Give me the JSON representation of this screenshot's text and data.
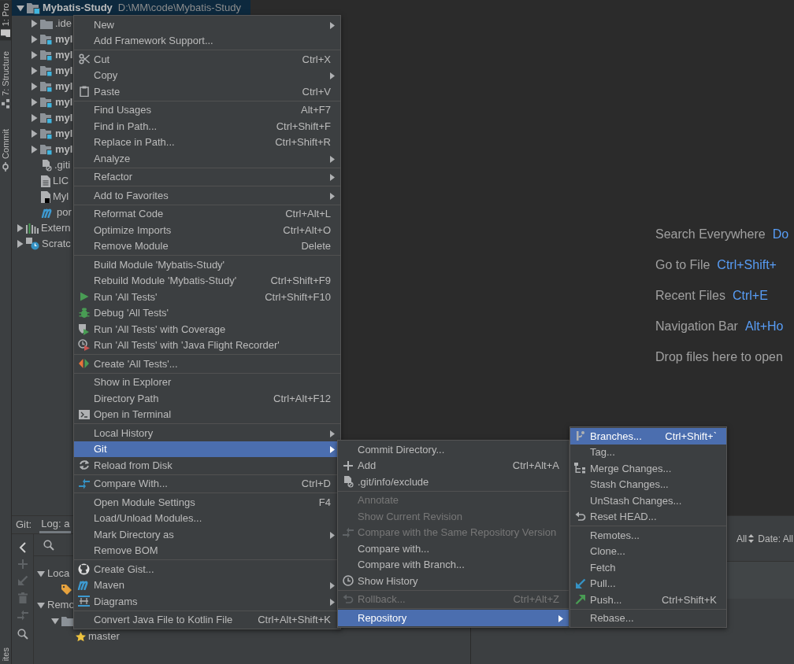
{
  "tool_strip": {
    "tabs": [
      {
        "label": "1: Pro",
        "selected": true
      },
      {
        "label": "7: Structure",
        "selected": false
      },
      {
        "label": "Commit",
        "selected": false
      }
    ],
    "bottom_tab": {
      "label": "ites"
    }
  },
  "project_tree": [
    {
      "label": "Mybatis-Study",
      "path": "D:\\MM\\code\\Mybatis-Study",
      "kind": "project",
      "expanded": true,
      "selected": true,
      "children": [
        {
          "label": ".ide",
          "kind": "folder",
          "expanded": false,
          "selected": false
        },
        {
          "label": "myl",
          "kind": "module",
          "expanded": false,
          "selected": false
        },
        {
          "label": "myl",
          "kind": "module",
          "expanded": false,
          "selected": false
        },
        {
          "label": "myl",
          "kind": "module",
          "expanded": false,
          "selected": false
        },
        {
          "label": "myl",
          "kind": "module",
          "expanded": false,
          "selected": false
        },
        {
          "label": "myl",
          "kind": "module",
          "expanded": false,
          "selected": false
        },
        {
          "label": "myl",
          "kind": "module",
          "expanded": false,
          "selected": false
        },
        {
          "label": "myl",
          "kind": "module",
          "expanded": false,
          "selected": false
        },
        {
          "label": "myl",
          "kind": "module",
          "expanded": false,
          "selected": false
        },
        {
          "label": ".giti",
          "kind": "ignored",
          "selected": false
        },
        {
          "label": "LIC",
          "kind": "text",
          "selected": false
        },
        {
          "label": "Myl",
          "kind": "markdown",
          "selected": false
        },
        {
          "label": "por",
          "kind": "maven",
          "selected": false
        }
      ]
    },
    {
      "label": "Extern",
      "kind": "library",
      "expanded": false,
      "selected": false
    },
    {
      "label": "Scratc",
      "kind": "scratch",
      "expanded": false,
      "selected": false
    }
  ],
  "editor_hints": [
    {
      "label": "Search Everywhere",
      "shortcut": "Do"
    },
    {
      "label": "Go to File",
      "shortcut": "Ctrl+Shift+"
    },
    {
      "label": "Recent Files",
      "shortcut": "Ctrl+E"
    },
    {
      "label": "Navigation Bar",
      "shortcut": "Alt+Ho"
    },
    {
      "label": "Drop files here to open"
    }
  ],
  "git_panel": {
    "title": "Git:",
    "tabs": [
      {
        "label": "Log: a",
        "selected": true
      }
    ],
    "tree": [
      {
        "label": "Loca",
        "expanded": true,
        "children": [
          {
            "kind": "tag"
          }
        ]
      },
      {
        "label": "Remo",
        "expanded": true,
        "children": [
          {
            "kind": "folder",
            "expanded": true,
            "children": [
              {
                "label": "master",
                "kind": "branch"
              }
            ]
          }
        ]
      }
    ]
  },
  "log_filters": [
    {
      "label": "All"
    },
    {
      "label": "Date: All"
    }
  ],
  "context_menu": {
    "groups": [
      [
        {
          "label": "New",
          "has_submenu": true,
          "selected": false
        },
        {
          "label": "Add Framework Support...",
          "has_submenu": false,
          "selected": false
        }
      ],
      [
        {
          "label": "Cut",
          "shortcut": "Ctrl+X",
          "has_submenu": false,
          "selected": false
        },
        {
          "label": "Copy",
          "has_submenu": true,
          "selected": false
        },
        {
          "label": "Paste",
          "shortcut": "Ctrl+V",
          "has_submenu": false,
          "selected": false
        }
      ],
      [
        {
          "label": "Find Usages",
          "shortcut": "Alt+F7",
          "has_submenu": false,
          "selected": false
        },
        {
          "label": "Find in Path...",
          "shortcut": "Ctrl+Shift+F",
          "has_submenu": false,
          "selected": false
        },
        {
          "label": "Replace in Path...",
          "shortcut": "Ctrl+Shift+R",
          "has_submenu": false,
          "selected": false
        },
        {
          "label": "Analyze",
          "has_submenu": true,
          "selected": false
        }
      ],
      [
        {
          "label": "Refactor",
          "has_submenu": true,
          "selected": false
        }
      ],
      [
        {
          "label": "Add to Favorites",
          "has_submenu": true,
          "selected": false
        }
      ],
      [
        {
          "label": "Reformat Code",
          "shortcut": "Ctrl+Alt+L",
          "has_submenu": false,
          "selected": false
        },
        {
          "label": "Optimize Imports",
          "shortcut": "Ctrl+Alt+O",
          "has_submenu": false,
          "selected": false
        },
        {
          "label": "Remove Module",
          "shortcut": "Delete",
          "has_submenu": false,
          "selected": false
        }
      ],
      [
        {
          "label": "Build Module 'Mybatis-Study'",
          "has_submenu": false,
          "selected": false
        },
        {
          "label": "Rebuild Module 'Mybatis-Study'",
          "shortcut": "Ctrl+Shift+F9",
          "has_submenu": false,
          "selected": false
        },
        {
          "label": "Run 'All Tests'",
          "shortcut": "Ctrl+Shift+F10",
          "has_submenu": false,
          "selected": false
        },
        {
          "label": "Debug 'All Tests'",
          "has_submenu": false,
          "selected": false
        },
        {
          "label": "Run 'All Tests' with Coverage",
          "has_submenu": false,
          "selected": false
        },
        {
          "label": "Run 'All Tests' with 'Java Flight Recorder'",
          "has_submenu": false,
          "selected": false
        }
      ],
      [
        {
          "label": "Create 'All Tests'...",
          "has_submenu": false,
          "selected": false
        }
      ],
      [
        {
          "label": "Show in Explorer",
          "has_submenu": false,
          "selected": false
        },
        {
          "label": "Directory Path",
          "shortcut": "Ctrl+Alt+F12",
          "has_submenu": false,
          "selected": false
        },
        {
          "label": "Open in Terminal",
          "has_submenu": false,
          "selected": false
        }
      ],
      [
        {
          "label": "Local History",
          "has_submenu": true,
          "selected": false
        },
        {
          "label": "Git",
          "has_submenu": true,
          "selected": true
        },
        {
          "label": "Reload from Disk",
          "has_submenu": false,
          "selected": false
        }
      ],
      [
        {
          "label": "Compare With...",
          "shortcut": "Ctrl+D",
          "has_submenu": false,
          "selected": false
        }
      ],
      [
        {
          "label": "Open Module Settings",
          "shortcut": "F4",
          "has_submenu": false,
          "selected": false
        },
        {
          "label": "Load/Unload Modules...",
          "has_submenu": false,
          "selected": false
        },
        {
          "label": "Mark Directory as",
          "has_submenu": true,
          "selected": false
        },
        {
          "label": "Remove BOM",
          "has_submenu": false,
          "selected": false
        }
      ],
      [
        {
          "label": "Create Gist...",
          "has_submenu": false,
          "selected": false
        },
        {
          "label": "Maven",
          "has_submenu": true,
          "selected": false
        },
        {
          "label": "Diagrams",
          "has_submenu": true,
          "selected": false
        }
      ],
      [
        {
          "label": "Convert Java File to Kotlin File",
          "shortcut": "Ctrl+Alt+Shift+K",
          "has_submenu": false,
          "selected": false
        }
      ]
    ]
  },
  "git_menu": {
    "groups": [
      [
        {
          "label": "Commit Directory...",
          "has_submenu": false,
          "disabled": false,
          "selected": false
        },
        {
          "label": "Add",
          "shortcut": "Ctrl+Alt+A",
          "has_submenu": false,
          "disabled": false,
          "selected": false
        },
        {
          "label": ".git/info/exclude",
          "has_submenu": false,
          "disabled": false,
          "selected": false
        }
      ],
      [
        {
          "label": "Annotate",
          "has_submenu": false,
          "disabled": true,
          "selected": false
        },
        {
          "label": "Show Current Revision",
          "has_submenu": false,
          "disabled": true,
          "selected": false
        },
        {
          "label": "Compare with the Same Repository Version",
          "has_submenu": false,
          "disabled": true,
          "selected": false
        },
        {
          "label": "Compare with...",
          "has_submenu": false,
          "disabled": false,
          "selected": false
        },
        {
          "label": "Compare with Branch...",
          "has_submenu": false,
          "disabled": false,
          "selected": false
        },
        {
          "label": "Show History",
          "has_submenu": false,
          "disabled": false,
          "selected": false
        }
      ],
      [
        {
          "label": "Rollback...",
          "shortcut": "Ctrl+Alt+Z",
          "has_submenu": false,
          "disabled": true,
          "selected": false
        }
      ],
      [
        {
          "label": "Repository",
          "has_submenu": true,
          "disabled": false,
          "selected": true
        }
      ]
    ]
  },
  "repository_menu": {
    "groups": [
      [
        {
          "label": "Branches...",
          "shortcut": "Ctrl+Shift+`",
          "selected": true
        },
        {
          "label": "Tag...",
          "selected": false
        },
        {
          "label": "Merge Changes...",
          "selected": false
        },
        {
          "label": "Stash Changes...",
          "selected": false
        },
        {
          "label": "UnStash Changes...",
          "selected": false
        },
        {
          "label": "Reset HEAD...",
          "selected": false
        }
      ],
      [
        {
          "label": "Remotes...",
          "selected": false
        },
        {
          "label": "Clone...",
          "selected": false
        },
        {
          "label": "Fetch",
          "selected": false
        },
        {
          "label": "Pull...",
          "selected": false
        },
        {
          "label": "Push...",
          "shortcut": "Ctrl+Shift+K",
          "selected": false
        }
      ],
      [
        {
          "label": "Rebase...",
          "selected": false
        }
      ]
    ]
  }
}
